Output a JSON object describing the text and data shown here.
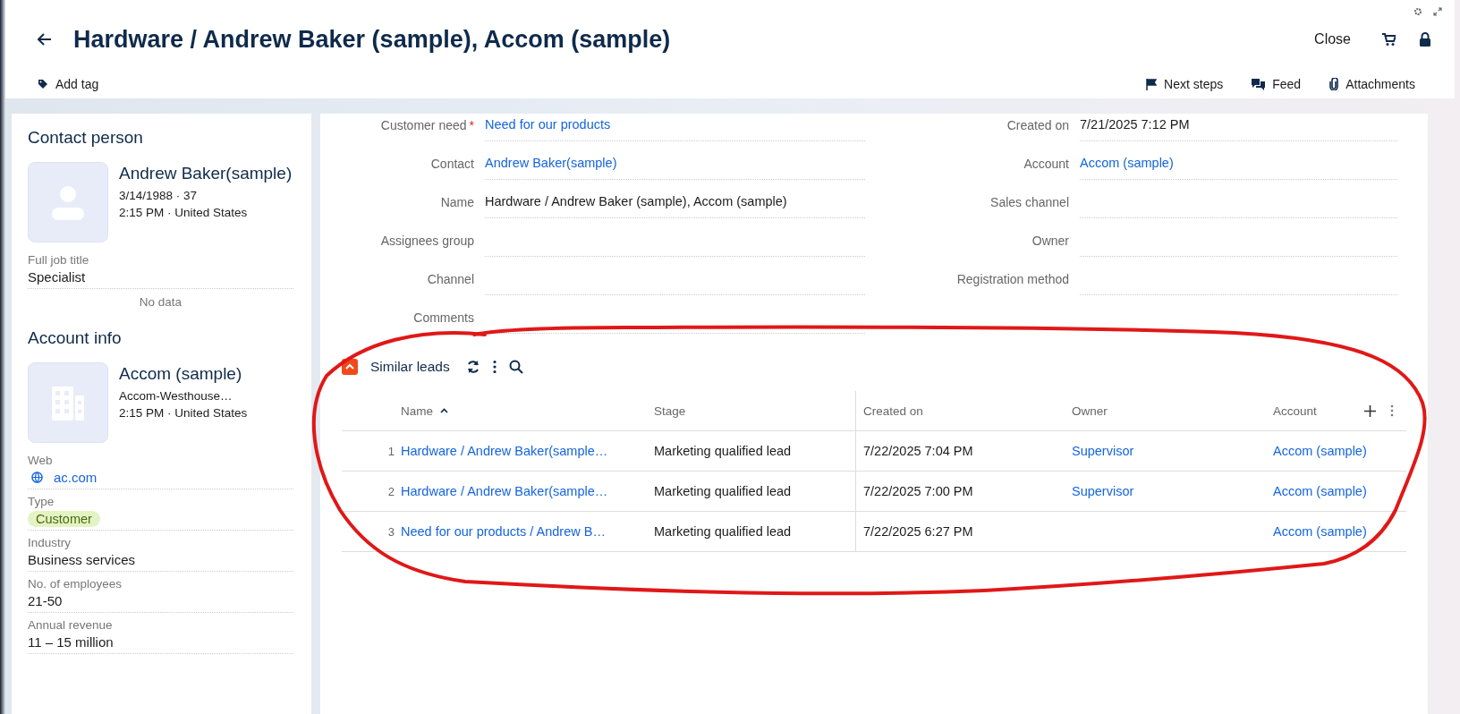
{
  "header": {
    "title": "Hardware / Andrew Baker (sample), Accom (sample)",
    "close": "Close",
    "add_tag": "Add tag",
    "actions": [
      {
        "kind": "flag",
        "label": "Next steps"
      },
      {
        "kind": "chat",
        "label": "Feed"
      },
      {
        "kind": "clip",
        "label": "Attachments"
      }
    ]
  },
  "contact": {
    "title": "Contact person",
    "name": "Andrew Baker(sample)",
    "line1": "3/14/1988 · 37",
    "line2": "2:15 PM · United States",
    "fields": [
      {
        "kind": "text",
        "label": "Full job title",
        "value": "Specialist"
      }
    ],
    "note": "No data"
  },
  "account": {
    "title": "Account info",
    "name": "Accom (sample)",
    "line1": "Accom-Westhouse…",
    "line2": "2:15 PM · United States",
    "fields": [
      {
        "kind": "link",
        "label": "Web",
        "value": "ac.com"
      },
      {
        "kind": "tag",
        "label": "Type",
        "value": "Customer"
      },
      {
        "kind": "text",
        "label": "Industry",
        "value": "Business services"
      },
      {
        "kind": "text",
        "label": "No. of employees",
        "value": "21-50"
      },
      {
        "kind": "text",
        "label": "Annual revenue",
        "value": "11 – 15 million"
      }
    ]
  },
  "form": {
    "left": [
      {
        "label": "Customer need",
        "required_mark": "*",
        "kind": "link",
        "value": "Need for our products"
      },
      {
        "label": "Contact",
        "kind": "link",
        "value": "Andrew Baker(sample)"
      },
      {
        "label": "Name",
        "kind": "text",
        "value": "Hardware / Andrew Baker (sample), Accom (sample)"
      },
      {
        "label": "Assignees group"
      },
      {
        "label": "Channel"
      },
      {
        "label": "Comments"
      }
    ],
    "right": [
      {
        "label": "Created on",
        "kind": "text",
        "value": "7/21/2025 7:12 PM"
      },
      {
        "label": "Account",
        "kind": "link",
        "value": "Accom (sample)"
      },
      {
        "label": "Sales channel"
      },
      {
        "label": "Owner"
      },
      {
        "label": "Registration method"
      }
    ]
  },
  "similar_leads": {
    "title": "Similar leads",
    "expanded": true,
    "columns": [
      {
        "label": "Name",
        "sorted": true
      },
      {
        "label": "Stage",
        "sorted": false
      },
      {
        "label": "Created on",
        "sorted": false
      },
      {
        "label": "Owner",
        "sorted": false
      },
      {
        "label": "Account",
        "sorted": false
      }
    ],
    "rows": [
      {
        "index": "1",
        "name": "Hardware / Andrew Baker(sample…",
        "stage": "Marketing qualified lead",
        "created_on": "7/22/2025 7:04 PM",
        "owner": "Supervisor",
        "account": "Accom (sample)"
      },
      {
        "index": "2",
        "name": "Hardware / Andrew Baker(sample…",
        "stage": "Marketing qualified lead",
        "created_on": "7/22/2025 7:00 PM",
        "owner": "Supervisor",
        "account": "Accom (sample)"
      },
      {
        "index": "3",
        "name": "Need for our products / Andrew B…",
        "stage": "Marketing qualified lead",
        "created_on": "7/22/2025 6:27 PM",
        "account": "Accom (sample)"
      }
    ]
  },
  "annotation": {
    "kind": "freehand-ellipse"
  }
}
